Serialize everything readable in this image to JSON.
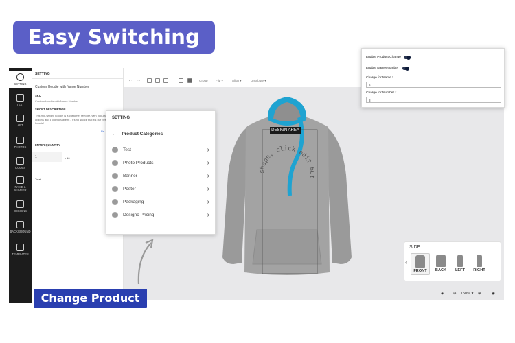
{
  "badge_label": "Easy Switching",
  "change_label": "Change Product",
  "sidebar": {
    "items": [
      {
        "label": "SETTING",
        "icon": "gear-icon"
      },
      {
        "label": "TEXT",
        "icon": "text-icon"
      },
      {
        "label": "ART",
        "icon": "art-icon"
      },
      {
        "label": "PHOTOS",
        "icon": "photo-icon"
      },
      {
        "label": "CODES",
        "icon": "qr-icon"
      },
      {
        "label": "NAME & NUMBER",
        "icon": "hash-icon"
      },
      {
        "label": "DESIGNS",
        "icon": "designs-icon"
      },
      {
        "label": "BACKGROUND",
        "icon": "background-icon"
      },
      {
        "label": "TEMPLATES",
        "icon": "templates-icon"
      }
    ]
  },
  "panel": {
    "header": "SETTING",
    "product_name": "Custom Hoodie with Name Number",
    "sku_label": "SKU",
    "sku_value": "Custom Hoodie with Name Number",
    "short_desc_label": "SHORT DESCRIPTION",
    "short_desc": "This mid-weight hoodie is a customer favorite, with popular color options and a comfortable fit - it's no shock that it's our best selling hoodie!",
    "more": "Re",
    "enter_qty_label": "ENTER QUANTITY",
    "qty_value": "1",
    "qty_mult": "x 10",
    "total_label": "Total"
  },
  "toolbar": {
    "group": "Group",
    "flip": "Flip ▾",
    "align": "Align ▾",
    "distribute": "Distribute ▾"
  },
  "design_area": "DESIGN AREA",
  "curved_text": "shape, click edit but",
  "menu": {
    "header": "SETTING",
    "back": "←",
    "title": "Product Categories",
    "categories": [
      "Test",
      "Photo Products",
      "Banner",
      "Poster",
      "Packaging",
      "Designo Pricing"
    ]
  },
  "popover": {
    "enable_product_change": "Enable Product Change",
    "enable_name_number": "Enable Name/Number",
    "charge_name_label": "Charge for Name *",
    "charge_name_value": "5",
    "charge_number_label": "Charge for Number *",
    "charge_number_value": "8"
  },
  "side": {
    "title": "SIDE",
    "options": [
      "FRONT",
      "BACK",
      "LEFT",
      "RIGHT"
    ],
    "selected": "FRONT"
  },
  "zoom": "150% ▾",
  "colors": {
    "badge": "#5b5fc7",
    "change_button": "#2a3fb0",
    "hoodie_body": "#9c9c9c",
    "hoodie_accent": "#1fa3d1",
    "sidebar": "#1c1c1c"
  }
}
